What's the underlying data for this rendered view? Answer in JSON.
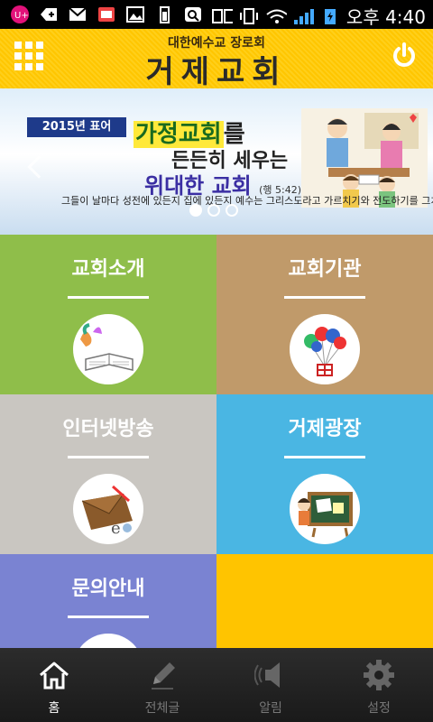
{
  "status_bar": {
    "time": "오후 4:40"
  },
  "header": {
    "subtitle": "대한예수교 장로회",
    "title": "거제교회"
  },
  "banner": {
    "year_label": "2015년 표어",
    "headline_highlight": "가정교회",
    "headline_suffix": "를",
    "line2": "든든히 세우는",
    "line3": "위대한 교회",
    "reference": "(행 5:42)",
    "verse": "그들이 날마다 성전에 있든지 집에 있든지 예수는 그리스도라고 가르치기와 전도하기를 그치지 아니하니라",
    "slides": 3,
    "active_slide": 1
  },
  "tiles": [
    {
      "label": "교회소개",
      "color": "#8fbe4a",
      "icon": "book-balloons-icon"
    },
    {
      "label": "교회기관",
      "color": "#c09a6a",
      "icon": "balloons-gift-icon"
    },
    {
      "label": "인터넷방송",
      "color": "#c9c6c1",
      "icon": "envelope-icon"
    },
    {
      "label": "거제광장",
      "color": "#4ab6e3",
      "icon": "chalkboard-icon"
    },
    {
      "label": "문의안내",
      "color": "#7a83d2",
      "icon": "contact-icon"
    }
  ],
  "bottom_nav": [
    {
      "label": "홈",
      "icon": "home-icon",
      "active": true
    },
    {
      "label": "전체글",
      "icon": "pencil-icon",
      "active": false
    },
    {
      "label": "알림",
      "icon": "speaker-icon",
      "active": false
    },
    {
      "label": "설정",
      "icon": "gear-icon",
      "active": false
    }
  ]
}
